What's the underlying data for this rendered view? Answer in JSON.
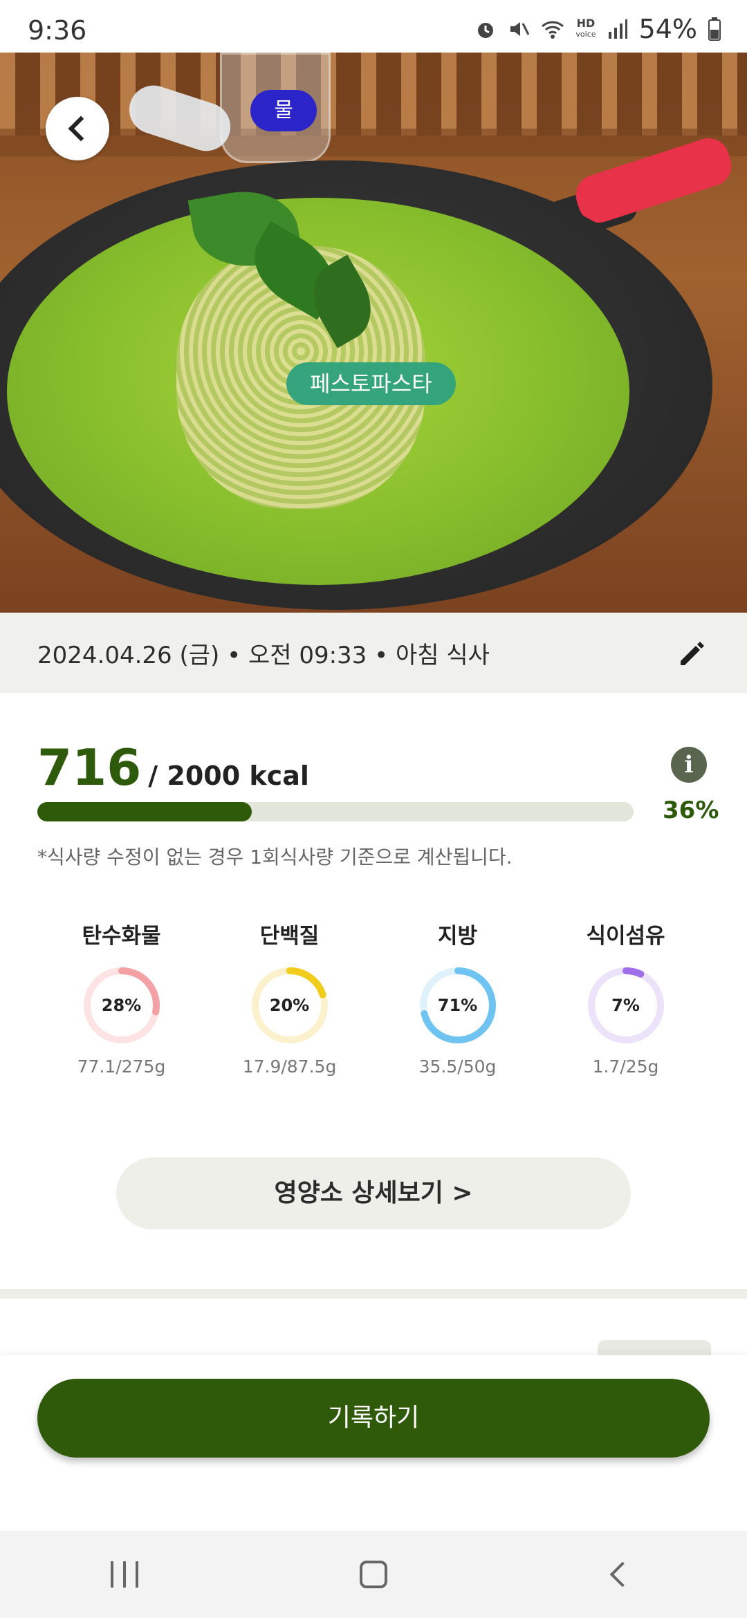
{
  "status_bar": {
    "time": "9:36",
    "hd_label": "HD",
    "voice_label": "voice",
    "battery": "54%",
    "icons": [
      "alarm-icon",
      "mute-icon",
      "wifi-icon",
      "hd-voice-icon",
      "signal-icon",
      "battery-icon"
    ]
  },
  "hero": {
    "water_tag": "물",
    "food_tag": "페스토파스타"
  },
  "meal": {
    "datetime": "2024.04.26 (금) • 오전 09:33 • 아침 식사"
  },
  "calories": {
    "value": "716",
    "total": "/ 2000 kcal",
    "percent": "36%",
    "progress_fraction": 0.36,
    "note": "*식사량 수정이 없는 경우 1회식사량 기준으로 계산됩니다."
  },
  "nutrients": [
    {
      "name": "탄수화물",
      "percent_label": "28%",
      "percent": 28,
      "amount": "77.1/275g",
      "color": "#f4a1a6",
      "track": "#fde3e4"
    },
    {
      "name": "단백질",
      "percent_label": "20%",
      "percent": 20,
      "amount": "17.9/87.5g",
      "color": "#f2cc1a",
      "track": "#fbf1cc"
    },
    {
      "name": "지방",
      "percent_label": "71%",
      "percent": 71,
      "amount": "35.5/50g",
      "color": "#6ec3f0",
      "track": "#dff1fb"
    },
    {
      "name": "식이섬유",
      "percent_label": "7%",
      "percent": 7,
      "amount": "1.7/25g",
      "color": "#a06ee8",
      "track": "#ece3fa"
    }
  ],
  "buttons": {
    "detail": "영양소 상세보기 >",
    "record": "기록하기"
  },
  "colors": {
    "brand_green": "#2f5a0a",
    "water_tag_bg": "#2a24c9",
    "food_tag_bg": "#2ea37f"
  }
}
